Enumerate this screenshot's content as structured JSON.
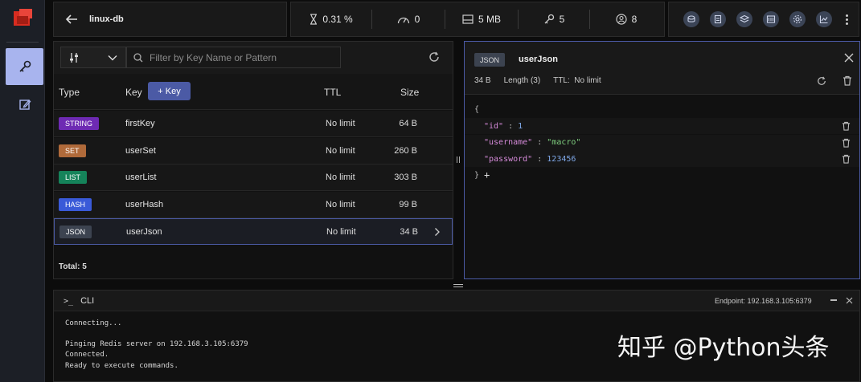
{
  "db": {
    "name": "linux-db"
  },
  "stats": {
    "cpu": "0.31 %",
    "ops": "0",
    "memory": "5 MB",
    "keys": "5",
    "clients": "8"
  },
  "filter": {
    "placeholder": "Filter by Key Name or Pattern"
  },
  "list": {
    "headers": {
      "type": "Type",
      "key": "Key",
      "ttl": "TTL",
      "size": "Size"
    },
    "add_key_label": "+ Key",
    "rows": [
      {
        "type": "STRING",
        "key": "firstKey",
        "ttl": "No limit",
        "size": "64 B"
      },
      {
        "type": "SET",
        "key": "userSet",
        "ttl": "No limit",
        "size": "260 B"
      },
      {
        "type": "LIST",
        "key": "userList",
        "ttl": "No limit",
        "size": "303 B"
      },
      {
        "type": "HASH",
        "key": "userHash",
        "ttl": "No limit",
        "size": "99 B"
      },
      {
        "type": "JSON",
        "key": "userJson",
        "ttl": "No limit",
        "size": "34 B"
      }
    ],
    "total": "Total: 5"
  },
  "type_colors": {
    "STRING": "#6e2ab3",
    "SET": "#b06a3a",
    "LIST": "#15835a",
    "HASH": "#3a5ad8",
    "JSON": "#3c4350"
  },
  "detail": {
    "type": "JSON",
    "name": "userJson",
    "size": "34 B",
    "length": "Length (3)",
    "ttl_label": "TTL:",
    "ttl_value": "No limit",
    "open_brace": "{",
    "close_brace": "}",
    "add_symbol": "+",
    "fields": [
      {
        "key": "\"id\"",
        "value": "1",
        "kind": "num"
      },
      {
        "key": "\"username\"",
        "value": "\"macro\"",
        "kind": "str"
      },
      {
        "key": "\"password\"",
        "value": "123456",
        "kind": "num"
      }
    ]
  },
  "cli": {
    "title": "CLI",
    "endpoint_label": "Endpoint:",
    "endpoint": "192.168.3.105:6379",
    "lines": [
      "Connecting...",
      "",
      "Pinging Redis server on 192.168.3.105:6379",
      "Connected.",
      "Ready to execute commands."
    ]
  },
  "watermark": "知乎 @Python头条"
}
